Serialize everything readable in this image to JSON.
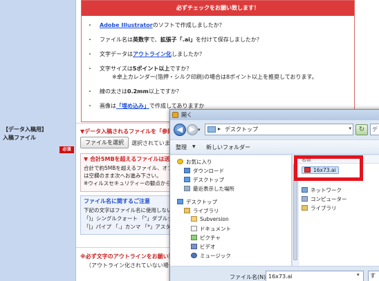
{
  "form": {
    "left_label_line1": "【データ入稿用】",
    "left_label_line2": "入稿ファイル",
    "required_badge": "必須",
    "panel_title": "必ずチェックをお願い致します！",
    "check_items": [
      {
        "prefix_link": "Adobe Illustrator",
        "text": "のソフトで作成しましたか？"
      },
      {
        "text_a": "ファイル名は",
        "bold_a": "英数字",
        "text_b": "で、",
        "bold_b": "拡張子「.ai」",
        "text_c": "を付けて保存しましたか？"
      },
      {
        "text_a": "文字データは",
        "link": "アウトライン化",
        "text_b": "しましたか？"
      },
      {
        "text_a": "文字サイズは",
        "bold": "5ポイント以上",
        "text_b": "ですか？",
        "note": "※卓上カレンダー(箔押・シルク印刷)の場合は8ポイント以上を推奨しております。"
      },
      {
        "text_a": "線の太さは",
        "bold": "0.2mm",
        "text_b": "以上ですか？"
      },
      {
        "text_a": "画像は",
        "link": "「埋め込み」",
        "text_b": "で作成してありますか"
      }
    ],
    "upload_warning": "▼データ入稿されるファイルを「参照」",
    "file_button": "ファイルを選択",
    "file_none": "選択されていま",
    "limit_title": "▼ 合計5MBを超えるファイルは送信",
    "limit_lines": [
      "合計で約5MBを超えるファイル、オフィ",
      "は空欄のまま次へお進み下さい。",
      "※ウィルスセキュリティーの観点からご"
    ],
    "name_title": "ファイル名に関するご注意",
    "name_lines": [
      "下記の文字はファイル名に使用しない",
      "「)」シングルクォート 「\"」ダブルクォー",
      "「|」パイプ 「.」カンマ 「*」アスタリスク"
    ],
    "outline_warning": "※必ず文字のアウトラインをお願い致し",
    "outline_sub": "（アウトライン化されていない場合、文字"
  },
  "dialog": {
    "title": "開く",
    "address": "デスクトップ",
    "search_placeholder": "デ",
    "toolbar": {
      "organize": "整理",
      "new_folder": "新しいフォルダー"
    },
    "nav_items": [
      {
        "label": "お気に入り",
        "icon": "star-icon"
      },
      {
        "label": "ダウンロード",
        "icon": "download-folder-icon"
      },
      {
        "label": "デスクトップ",
        "icon": "desktop-icon"
      },
      {
        "label": "最近表示した場所",
        "icon": "recent-places-icon"
      },
      {
        "label": "デスクトップ",
        "icon": "desktop-icon"
      },
      {
        "label": "ライブラリ",
        "icon": "library-icon"
      },
      {
        "label": "Subversion",
        "icon": "folder-icon"
      },
      {
        "label": "ドキュメント",
        "icon": "documents-icon"
      },
      {
        "label": "ピクチャ",
        "icon": "pictures-icon"
      },
      {
        "label": "ビデオ",
        "icon": "videos-icon"
      },
      {
        "label": "ミュージック",
        "icon": "music-icon"
      }
    ],
    "column_header": "名前",
    "files": [
      {
        "label": "16x73.ai",
        "icon": "illustrator-file-icon"
      },
      {
        "label": "ネットワーク",
        "icon": "network-icon"
      },
      {
        "label": "コンピューター",
        "icon": "computer-icon"
      },
      {
        "label": "ライブラリ",
        "icon": "library-icon"
      }
    ],
    "filename_label": "ファイル名(N):",
    "filename_value": "16x73.ai",
    "filetype_value": "す",
    "colors": {
      "highlight": "#e4131d",
      "titlebar": "#c9d9ee"
    }
  }
}
